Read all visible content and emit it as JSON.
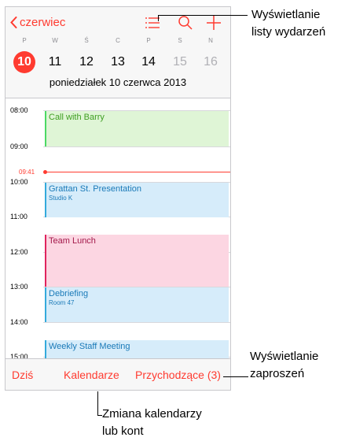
{
  "nav": {
    "back_label": "czerwiec"
  },
  "weekdays": [
    "P",
    "W",
    "Ś",
    "C",
    "P",
    "S",
    "N"
  ],
  "days": [
    "10",
    "11",
    "12",
    "13",
    "14",
    "15",
    "16"
  ],
  "selected_day": "10",
  "date_line": "poniedziałek  10 czerwca 2013",
  "hours": [
    "08:00",
    "09:00",
    "10:00",
    "11:00",
    "12:00",
    "13:00",
    "14:00",
    "15:00"
  ],
  "now_label": "09:41",
  "events": [
    {
      "title": "Call with Barry",
      "subtitle": "",
      "color": "#4cd964"
    },
    {
      "title": "Grattan St. Presentation",
      "subtitle": "Studio K",
      "color": "#34aadc"
    },
    {
      "title": "Team Lunch",
      "subtitle": "",
      "color": "#e0245e"
    },
    {
      "title": "Debriefing",
      "subtitle": "Room 47",
      "color": "#34aadc"
    },
    {
      "title": "Weekly Staff Meeting",
      "subtitle": "",
      "color": "#34aadc"
    }
  ],
  "toolbar": {
    "today": "Dziś",
    "calendars": "Kalendarze",
    "inbox": "Przychodzące (3)"
  },
  "callouts": {
    "list_view": [
      "Wyświetlanie",
      "listy wydarzeń"
    ],
    "invitations": [
      "Wyświetlanie",
      "zaproszeń"
    ],
    "calendars": [
      "Zmiana kalendarzy",
      "lub kont"
    ]
  },
  "accent_color": "#ff3b30"
}
